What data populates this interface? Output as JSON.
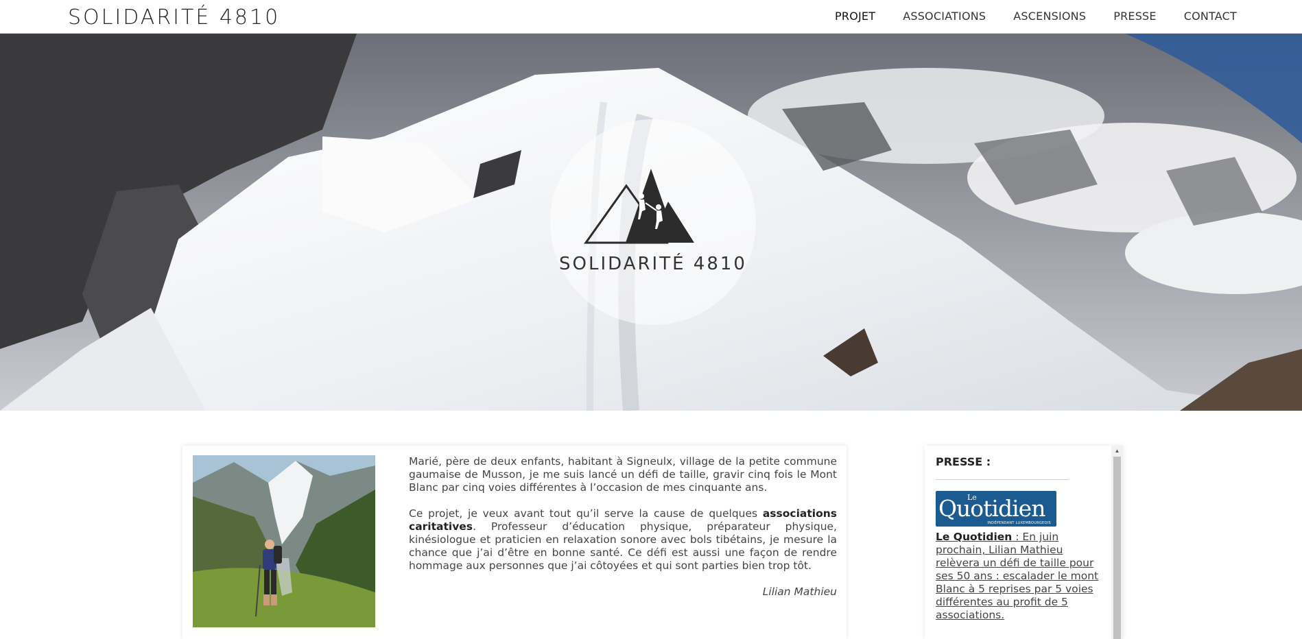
{
  "header": {
    "brand": "SOLIDARITÉ 4810",
    "nav": [
      "PROJET",
      "ASSOCIATIONS",
      "ASCENSIONS",
      "PRESSE",
      "CONTACT"
    ]
  },
  "hero": {
    "logo_text": "SOLIDARITÉ 4810",
    "logo_icon": "mountain-climbers-icon"
  },
  "main": {
    "paragraph1": "Marié, père de deux enfants, habitant à Signeulx, village de la petite commune gaumaise de Musson, je me suis lancé un défi de taille, gravir cinq fois le Mont Blanc par cinq voies différentes à l’occasion de mes cinquante ans.",
    "paragraph2_before": "Ce projet, je veux avant tout qu’il serve la cause de quelques ",
    "paragraph2_bold": "associations caritatives",
    "paragraph2_after": ". Professeur d’éducation physique, préparateur physique, kinésiologue et praticien en relaxation sonore avec bols tibétains, je mesure la chance que j’ai d’être en bonne santé. Ce défi est aussi une façon de rendre hommage aux personnes que j’ai côtoyées et qui sont parties bien trop tôt.",
    "signature": "Lilian Mathieu"
  },
  "press": {
    "title": "PRESSE :",
    "logo_le": "Le",
    "logo_name": "Quotidien",
    "logo_sub": "INDÉPENDANT LUXEMBOURGEOIS",
    "source": "Le Quotidien",
    "article": " : En juin prochain, Lilian Mathieu relèvera un défi de taille pour ses 50 ans : escalader le mont Blanc à 5 reprises par 5 voies différentes au profit de 5 associations."
  },
  "colors": {
    "press_logo_bg": "#1b5b8f",
    "text": "#444444"
  }
}
